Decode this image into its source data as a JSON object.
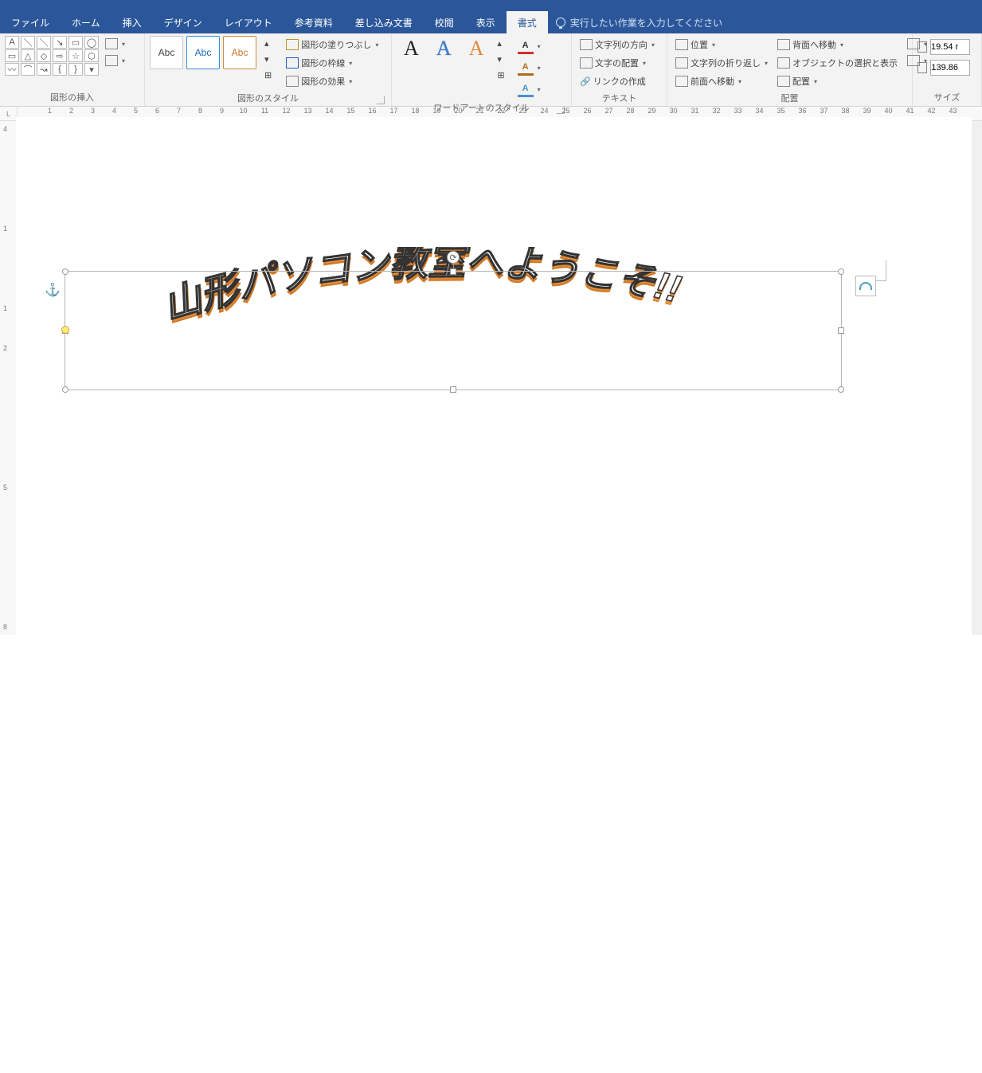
{
  "tabs": {
    "file": "ファイル",
    "home": "ホーム",
    "insert": "挿入",
    "design": "デザイン",
    "layout": "レイアウト",
    "references": "参考資料",
    "mailmerge": "差し込み文書",
    "review": "校閲",
    "view": "表示",
    "format": "書式",
    "tellme": "実行したい作業を入力してください"
  },
  "ribbon": {
    "insertShapes": {
      "label": "図形の挿入"
    },
    "shapeStyles": {
      "label": "図形のスタイル",
      "abc": "Abc",
      "fill": "図形の塗りつぶし",
      "outline": "図形の枠線",
      "effects": "図形の効果"
    },
    "wordartStyles": {
      "label": "ワードアートのスタイル"
    },
    "text": {
      "label": "テキスト",
      "direction": "文字列の方向",
      "align": "文字の配置",
      "link": "リンクの作成"
    },
    "arrange": {
      "label": "配置",
      "position": "位置",
      "sendBack": "背面へ移動",
      "wrap": "文字列の折り返し",
      "selectionPane": "オブジェクトの選択と表示",
      "bringFront": "前面へ移動",
      "alignBtn": "配置"
    },
    "size": {
      "label": "サイズ",
      "h": "19.54 r",
      "w": "139.86"
    }
  },
  "canvas": {
    "wordart_text": "山形パソコン教室へようこそ!!"
  }
}
